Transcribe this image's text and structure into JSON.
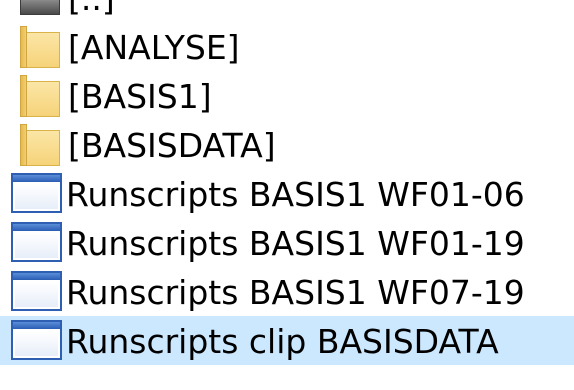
{
  "file_list": {
    "items": [
      {
        "label": "[..]",
        "icon": "parent-folder-icon",
        "type": "parent"
      },
      {
        "label": "[ANALYSE]",
        "icon": "folder-icon",
        "type": "folder"
      },
      {
        "label": "[BASIS1]",
        "icon": "folder-icon",
        "type": "folder"
      },
      {
        "label": "[BASISDATA]",
        "icon": "folder-icon",
        "type": "folder"
      },
      {
        "label": "Runscripts BASIS1 WF01-06",
        "icon": "script-window-icon",
        "type": "file"
      },
      {
        "label": "Runscripts BASIS1 WF01-19",
        "icon": "script-window-icon",
        "type": "file"
      },
      {
        "label": "Runscripts BASIS1 WF07-19",
        "icon": "script-window-icon",
        "type": "file"
      },
      {
        "label": "Runscripts clip BASISDATA",
        "icon": "script-window-icon",
        "type": "file",
        "selected": true
      }
    ]
  },
  "colors": {
    "selection": "#cce8ff",
    "folder": "#f6d37a",
    "window_border": "#2f5fb2"
  }
}
